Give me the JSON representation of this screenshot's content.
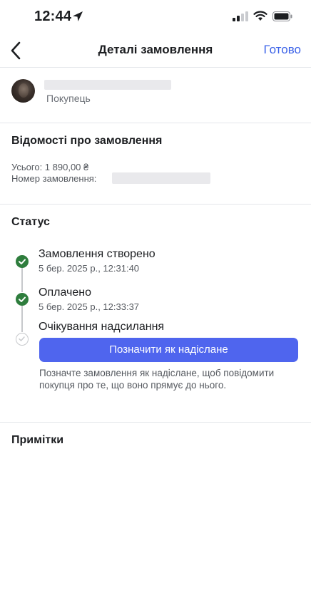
{
  "status_bar": {
    "time": "12:44",
    "icons": [
      "location-arrow-icon",
      "signal-icon",
      "wifi-icon",
      "battery-icon"
    ]
  },
  "nav": {
    "back_icon": "chevron-left-icon",
    "title": "Деталі замовлення",
    "done_label": "Готово"
  },
  "buyer": {
    "role_label": "Покупець"
  },
  "order_info": {
    "title": "Відомості про замовлення",
    "total": "Усього: 1 890,00 ₴",
    "order_number_label": "Номер замовлення:"
  },
  "status": {
    "title": "Статус",
    "steps": [
      {
        "title": "Замовлення створено",
        "date": "5 бер. 2025 р., 12:31:40",
        "state": "completed"
      },
      {
        "title": "Оплачено",
        "date": "5 бер. 2025 р., 12:33:37",
        "state": "completed"
      },
      {
        "title": "Очікування надсилання",
        "state": "pending"
      }
    ],
    "action_button": "Позначити як надіслане",
    "hint": "Позначте замовлення як надіслане, щоб повідомити покупця про те, що воно прямує до нього."
  },
  "notes": {
    "title": "Примітки"
  },
  "colors": {
    "accent": "#3b62e8",
    "button": "#4f65ee",
    "success": "#2e7d3d"
  }
}
